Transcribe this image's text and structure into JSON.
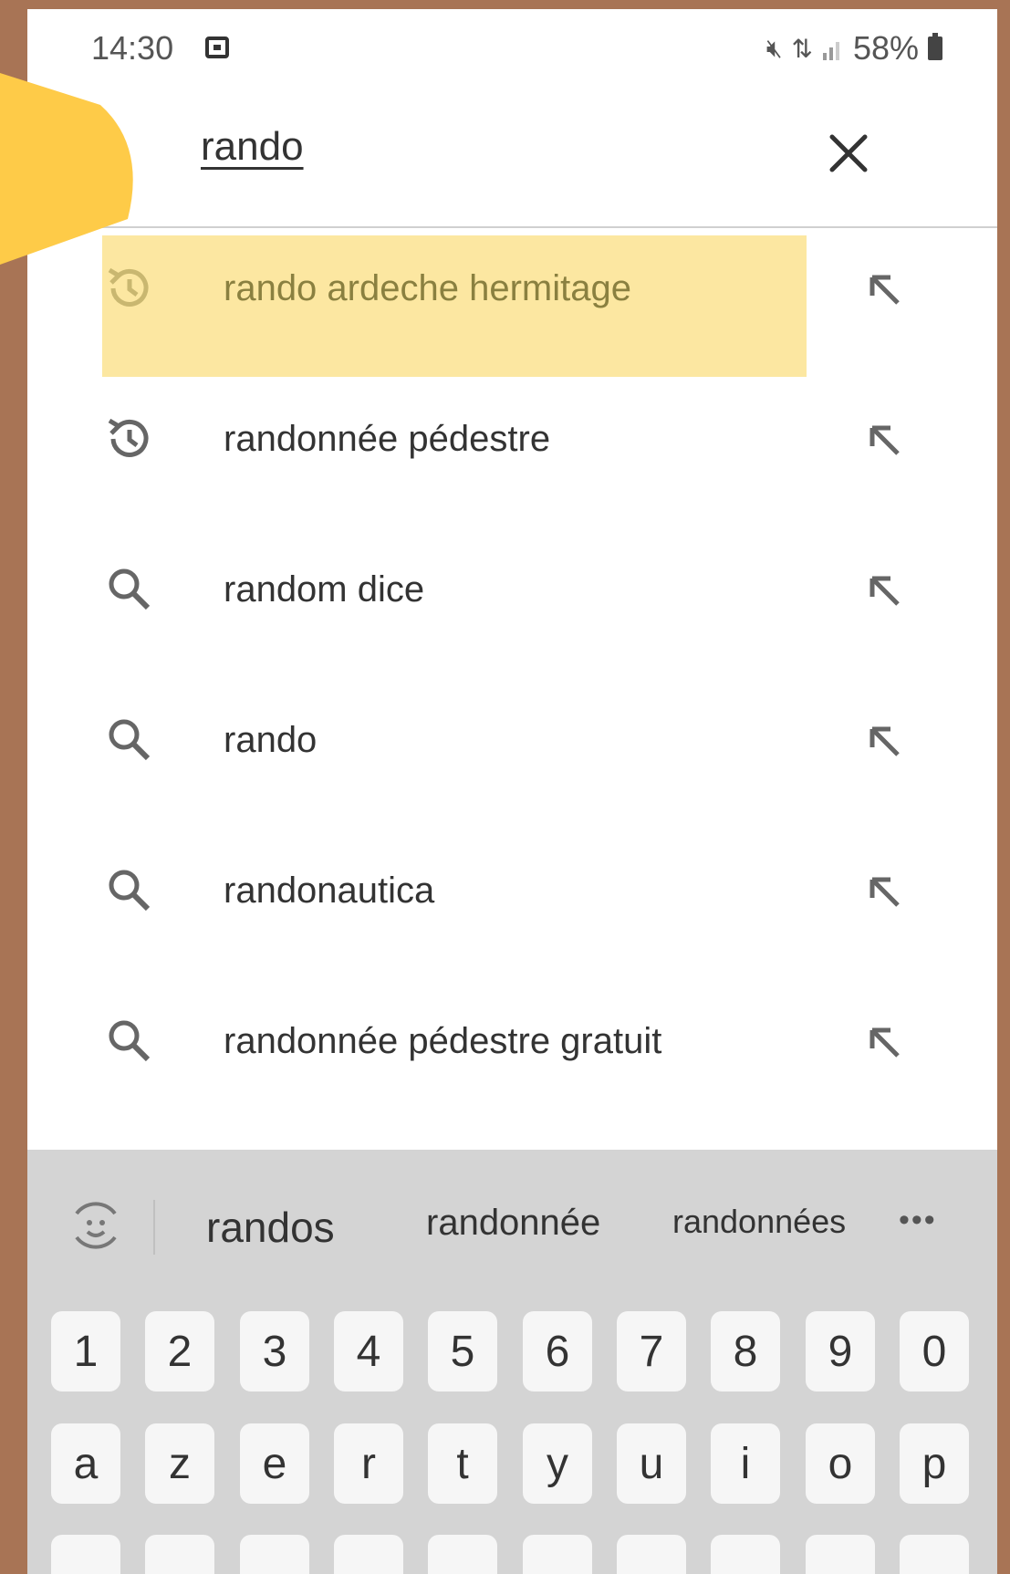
{
  "status_bar": {
    "time": "14:30",
    "battery": "58%"
  },
  "search": {
    "query": "rando"
  },
  "suggestions": [
    {
      "text": "rando ardeche hermitage",
      "icon": "history-icon",
      "highlighted": true
    },
    {
      "text": "randonnée pédestre",
      "icon": "history-icon"
    },
    {
      "text": "random dice",
      "icon": "search-icon"
    },
    {
      "text": "rando",
      "icon": "search-icon"
    },
    {
      "text": "randonautica",
      "icon": "search-icon"
    },
    {
      "text": "randonnée pédestre gratuit",
      "icon": "search-icon"
    }
  ],
  "keyboard": {
    "word_suggestions": [
      "randos",
      "randonnée",
      "randonnées"
    ],
    "more": "•••",
    "number_row": [
      "1",
      "2",
      "3",
      "4",
      "5",
      "6",
      "7",
      "8",
      "9",
      "0"
    ],
    "letter_row": [
      "a",
      "z",
      "e",
      "r",
      "t",
      "y",
      "u",
      "i",
      "o",
      "p"
    ]
  },
  "colors": {
    "highlight": "#fce7a1",
    "frame": "#a87455",
    "keyboard_bg": "#d4d4d4"
  }
}
